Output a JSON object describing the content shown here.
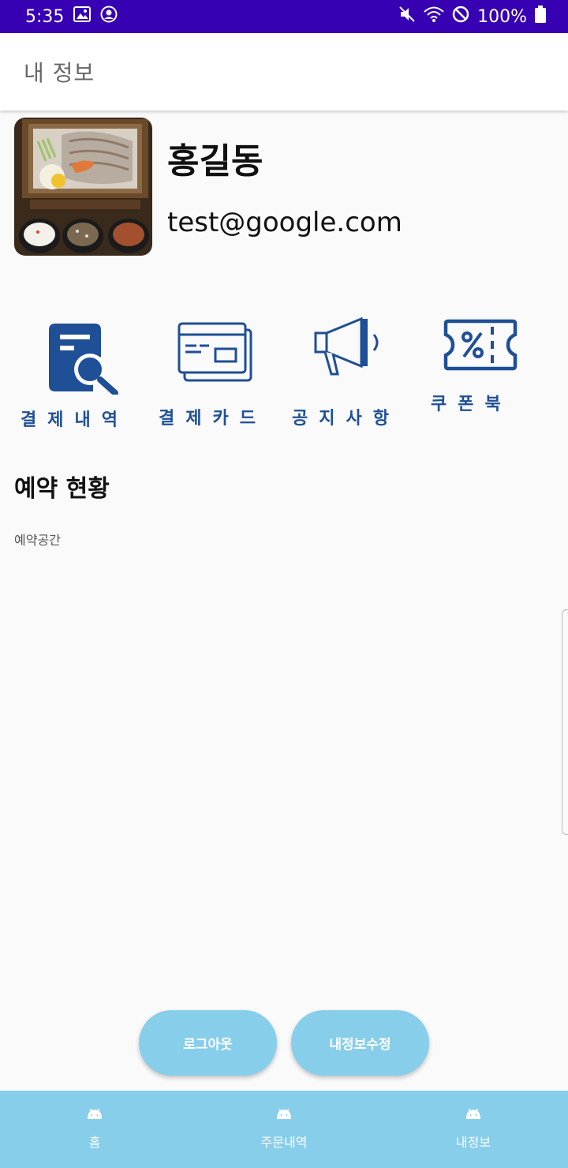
{
  "status_bar": {
    "time": "5:35",
    "battery": "100%",
    "left_icons": [
      "image-icon",
      "account-circle-icon"
    ],
    "right_icons": [
      "mute-icon",
      "wifi-icon",
      "do-not-disturb-icon",
      "battery-icon"
    ]
  },
  "app_bar": {
    "title": "내 정보"
  },
  "profile": {
    "name": "홍길동",
    "email": "test@google.com"
  },
  "menu": [
    {
      "label": "결제내역",
      "icon": "receipt-search-icon"
    },
    {
      "label": "결제카드",
      "icon": "credit-card-icon"
    },
    {
      "label": "공지사항",
      "icon": "megaphone-icon"
    },
    {
      "label": "쿠폰북",
      "icon": "coupon-icon"
    }
  ],
  "reservation": {
    "title": "예약 현황",
    "body": "예약공간"
  },
  "buttons": {
    "logout": "로그아웃",
    "edit_profile": "내정보수정"
  },
  "bottom_nav": [
    {
      "label": "홈",
      "icon": "android-icon"
    },
    {
      "label": "주문내역",
      "icon": "android-icon"
    },
    {
      "label": "내정보",
      "icon": "android-icon"
    }
  ],
  "colors": {
    "status_bar": "#3700b3",
    "accent": "#87ceeb",
    "icon_blue": "#1f4f96"
  }
}
